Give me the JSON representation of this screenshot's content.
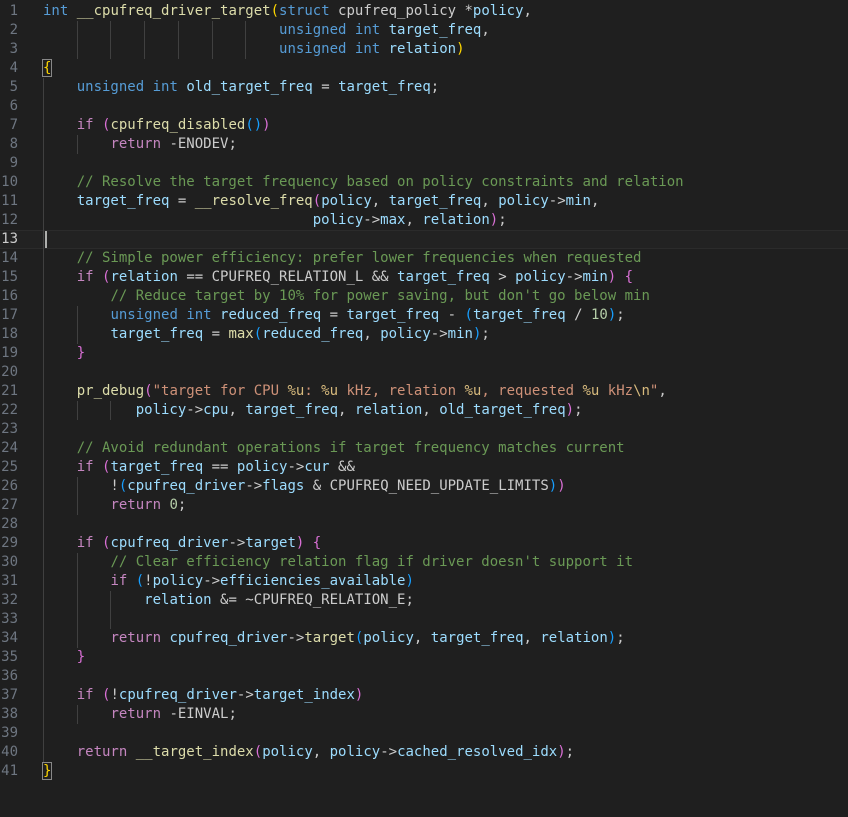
{
  "colors": {
    "background": "#1f1f1f",
    "line_number": "#6e7681",
    "keyword": "#569cd6",
    "control": "#c586c0",
    "function": "#dcdcaa",
    "variable": "#9cdcfe",
    "number": "#b5cea8",
    "string": "#ce9178",
    "comment": "#6a9955",
    "bracket_level_1": "#ffd700",
    "bracket_level_2": "#da70d6",
    "bracket_level_3": "#179fff"
  },
  "editor": {
    "current_line": 13,
    "lines": [
      {
        "n": "1",
        "t": [
          [
            "kw",
            "int"
          ],
          [
            "pl",
            " "
          ],
          [
            "fn",
            "__cpufreq_driver_target"
          ],
          [
            "b1",
            "("
          ],
          [
            "kw",
            "struct"
          ],
          [
            "pl",
            " cpufreq_policy "
          ],
          [
            "pl",
            "*"
          ],
          [
            "var",
            "policy"
          ],
          [
            "pl",
            ","
          ]
        ]
      },
      {
        "n": "2",
        "t": [
          [
            "pl",
            "                            "
          ],
          [
            "kw",
            "unsigned"
          ],
          [
            "pl",
            " "
          ],
          [
            "kw",
            "int"
          ],
          [
            "pl",
            " "
          ],
          [
            "var",
            "target_freq"
          ],
          [
            "pl",
            ","
          ]
        ]
      },
      {
        "n": "3",
        "t": [
          [
            "pl",
            "                            "
          ],
          [
            "kw",
            "unsigned"
          ],
          [
            "pl",
            " "
          ],
          [
            "kw",
            "int"
          ],
          [
            "pl",
            " "
          ],
          [
            "var",
            "relation"
          ],
          [
            "b1",
            ")"
          ]
        ]
      },
      {
        "n": "4",
        "t": [
          [
            "bm",
            "{"
          ]
        ]
      },
      {
        "n": "5",
        "t": [
          [
            "pl",
            "    "
          ],
          [
            "kw",
            "unsigned"
          ],
          [
            "pl",
            " "
          ],
          [
            "kw",
            "int"
          ],
          [
            "pl",
            " "
          ],
          [
            "var",
            "old_target_freq"
          ],
          [
            "pl",
            " = "
          ],
          [
            "var",
            "target_freq"
          ],
          [
            "pl",
            ";"
          ]
        ]
      },
      {
        "n": "6",
        "t": []
      },
      {
        "n": "7",
        "t": [
          [
            "pl",
            "    "
          ],
          [
            "ctl",
            "if"
          ],
          [
            "pl",
            " "
          ],
          [
            "b2",
            "("
          ],
          [
            "fn",
            "cpufreq_disabled"
          ],
          [
            "b3",
            "()"
          ],
          [
            "b2",
            ")"
          ]
        ]
      },
      {
        "n": "8",
        "t": [
          [
            "pl",
            "        "
          ],
          [
            "ctl",
            "return"
          ],
          [
            "pl",
            " -"
          ],
          [
            "const",
            "ENODEV"
          ],
          [
            "pl",
            ";"
          ]
        ]
      },
      {
        "n": "9",
        "t": []
      },
      {
        "n": "10",
        "t": [
          [
            "pl",
            "    "
          ],
          [
            "cmt",
            "// Resolve the target frequency based on policy constraints and relation"
          ]
        ]
      },
      {
        "n": "11",
        "t": [
          [
            "pl",
            "    "
          ],
          [
            "var",
            "target_freq"
          ],
          [
            "pl",
            " = "
          ],
          [
            "fn",
            "__resolve_freq"
          ],
          [
            "b2",
            "("
          ],
          [
            "var",
            "policy"
          ],
          [
            "pl",
            ", "
          ],
          [
            "var",
            "target_freq"
          ],
          [
            "pl",
            ", "
          ],
          [
            "var",
            "policy"
          ],
          [
            "pl",
            "->"
          ],
          [
            "var",
            "min"
          ],
          [
            "pl",
            ","
          ]
        ]
      },
      {
        "n": "12",
        "t": [
          [
            "pl",
            "                                "
          ],
          [
            "var",
            "policy"
          ],
          [
            "pl",
            "->"
          ],
          [
            "var",
            "max"
          ],
          [
            "pl",
            ", "
          ],
          [
            "var",
            "relation"
          ],
          [
            "b2",
            ")"
          ],
          [
            "pl",
            ";"
          ]
        ]
      },
      {
        "n": "13",
        "t": []
      },
      {
        "n": "14",
        "t": [
          [
            "pl",
            "    "
          ],
          [
            "cmt",
            "// Simple power efficiency: prefer lower frequencies when requested"
          ]
        ]
      },
      {
        "n": "15",
        "t": [
          [
            "pl",
            "    "
          ],
          [
            "ctl",
            "if"
          ],
          [
            "pl",
            " "
          ],
          [
            "b2",
            "("
          ],
          [
            "var",
            "relation"
          ],
          [
            "pl",
            " == "
          ],
          [
            "const",
            "CPUFREQ_RELATION_L"
          ],
          [
            "pl",
            " && "
          ],
          [
            "var",
            "target_freq"
          ],
          [
            "pl",
            " > "
          ],
          [
            "var",
            "policy"
          ],
          [
            "pl",
            "->"
          ],
          [
            "var",
            "min"
          ],
          [
            "b2",
            ")"
          ],
          [
            "pl",
            " "
          ],
          [
            "b2",
            "{"
          ]
        ]
      },
      {
        "n": "16",
        "t": [
          [
            "pl",
            "        "
          ],
          [
            "cmt",
            "// Reduce target by 10% for power saving, but don't go below min"
          ]
        ]
      },
      {
        "n": "17",
        "t": [
          [
            "pl",
            "        "
          ],
          [
            "kw",
            "unsigned"
          ],
          [
            "pl",
            " "
          ],
          [
            "kw",
            "int"
          ],
          [
            "pl",
            " "
          ],
          [
            "var",
            "reduced_freq"
          ],
          [
            "pl",
            " = "
          ],
          [
            "var",
            "target_freq"
          ],
          [
            "pl",
            " - "
          ],
          [
            "b3",
            "("
          ],
          [
            "var",
            "target_freq"
          ],
          [
            "pl",
            " / "
          ],
          [
            "num",
            "10"
          ],
          [
            "b3",
            ")"
          ],
          [
            "pl",
            ";"
          ]
        ]
      },
      {
        "n": "18",
        "t": [
          [
            "pl",
            "        "
          ],
          [
            "var",
            "target_freq"
          ],
          [
            "pl",
            " = "
          ],
          [
            "fn",
            "max"
          ],
          [
            "b3",
            "("
          ],
          [
            "var",
            "reduced_freq"
          ],
          [
            "pl",
            ", "
          ],
          [
            "var",
            "policy"
          ],
          [
            "pl",
            "->"
          ],
          [
            "var",
            "min"
          ],
          [
            "b3",
            ")"
          ],
          [
            "pl",
            ";"
          ]
        ]
      },
      {
        "n": "19",
        "t": [
          [
            "pl",
            "    "
          ],
          [
            "b2",
            "}"
          ]
        ]
      },
      {
        "n": "20",
        "t": []
      },
      {
        "n": "21",
        "t": [
          [
            "pl",
            "    "
          ],
          [
            "fn",
            "pr_debug"
          ],
          [
            "b2",
            "("
          ],
          [
            "str",
            "\"target for CPU "
          ],
          [
            "esc",
            "%u"
          ],
          [
            "str",
            ": "
          ],
          [
            "esc",
            "%u"
          ],
          [
            "str",
            " kHz, relation "
          ],
          [
            "esc",
            "%u"
          ],
          [
            "str",
            ", requested "
          ],
          [
            "esc",
            "%u"
          ],
          [
            "str",
            " kHz"
          ],
          [
            "esc",
            "\\n"
          ],
          [
            "str",
            "\""
          ],
          [
            "pl",
            ","
          ]
        ]
      },
      {
        "n": "22",
        "t": [
          [
            "pl",
            "           "
          ],
          [
            "var",
            "policy"
          ],
          [
            "pl",
            "->"
          ],
          [
            "var",
            "cpu"
          ],
          [
            "pl",
            ", "
          ],
          [
            "var",
            "target_freq"
          ],
          [
            "pl",
            ", "
          ],
          [
            "var",
            "relation"
          ],
          [
            "pl",
            ", "
          ],
          [
            "var",
            "old_target_freq"
          ],
          [
            "b2",
            ")"
          ],
          [
            "pl",
            ";"
          ]
        ]
      },
      {
        "n": "23",
        "t": []
      },
      {
        "n": "24",
        "t": [
          [
            "pl",
            "    "
          ],
          [
            "cmt",
            "// Avoid redundant operations if target frequency matches current"
          ]
        ]
      },
      {
        "n": "25",
        "t": [
          [
            "pl",
            "    "
          ],
          [
            "ctl",
            "if"
          ],
          [
            "pl",
            " "
          ],
          [
            "b2",
            "("
          ],
          [
            "var",
            "target_freq"
          ],
          [
            "pl",
            " == "
          ],
          [
            "var",
            "policy"
          ],
          [
            "pl",
            "->"
          ],
          [
            "var",
            "cur"
          ],
          [
            "pl",
            " &&"
          ]
        ]
      },
      {
        "n": "26",
        "t": [
          [
            "pl",
            "        !"
          ],
          [
            "b3",
            "("
          ],
          [
            "var",
            "cpufreq_driver"
          ],
          [
            "pl",
            "->"
          ],
          [
            "var",
            "flags"
          ],
          [
            "pl",
            " & "
          ],
          [
            "const",
            "CPUFREQ_NEED_UPDATE_LIMITS"
          ],
          [
            "b3",
            ")"
          ],
          [
            "b2",
            ")"
          ]
        ]
      },
      {
        "n": "27",
        "t": [
          [
            "pl",
            "        "
          ],
          [
            "ctl",
            "return"
          ],
          [
            "pl",
            " "
          ],
          [
            "num",
            "0"
          ],
          [
            "pl",
            ";"
          ]
        ]
      },
      {
        "n": "28",
        "t": []
      },
      {
        "n": "29",
        "t": [
          [
            "pl",
            "    "
          ],
          [
            "ctl",
            "if"
          ],
          [
            "pl",
            " "
          ],
          [
            "b2",
            "("
          ],
          [
            "var",
            "cpufreq_driver"
          ],
          [
            "pl",
            "->"
          ],
          [
            "var",
            "target"
          ],
          [
            "b2",
            ")"
          ],
          [
            "pl",
            " "
          ],
          [
            "b2",
            "{"
          ]
        ]
      },
      {
        "n": "30",
        "t": [
          [
            "pl",
            "        "
          ],
          [
            "cmt",
            "// Clear efficiency relation flag if driver doesn't support it"
          ]
        ]
      },
      {
        "n": "31",
        "t": [
          [
            "pl",
            "        "
          ],
          [
            "ctl",
            "if"
          ],
          [
            "pl",
            " "
          ],
          [
            "b3",
            "("
          ],
          [
            "pl",
            "!"
          ],
          [
            "var",
            "policy"
          ],
          [
            "pl",
            "->"
          ],
          [
            "var",
            "efficiencies_available"
          ],
          [
            "b3",
            ")"
          ]
        ]
      },
      {
        "n": "32",
        "t": [
          [
            "pl",
            "            "
          ],
          [
            "var",
            "relation"
          ],
          [
            "pl",
            " &= ~"
          ],
          [
            "const",
            "CPUFREQ_RELATION_E"
          ],
          [
            "pl",
            ";"
          ]
        ]
      },
      {
        "n": "33",
        "t": []
      },
      {
        "n": "34",
        "t": [
          [
            "pl",
            "        "
          ],
          [
            "ctl",
            "return"
          ],
          [
            "pl",
            " "
          ],
          [
            "var",
            "cpufreq_driver"
          ],
          [
            "pl",
            "->"
          ],
          [
            "fn",
            "target"
          ],
          [
            "b3",
            "("
          ],
          [
            "var",
            "policy"
          ],
          [
            "pl",
            ", "
          ],
          [
            "var",
            "target_freq"
          ],
          [
            "pl",
            ", "
          ],
          [
            "var",
            "relation"
          ],
          [
            "b3",
            ")"
          ],
          [
            "pl",
            ";"
          ]
        ]
      },
      {
        "n": "35",
        "t": [
          [
            "pl",
            "    "
          ],
          [
            "b2",
            "}"
          ]
        ]
      },
      {
        "n": "36",
        "t": []
      },
      {
        "n": "37",
        "t": [
          [
            "pl",
            "    "
          ],
          [
            "ctl",
            "if"
          ],
          [
            "pl",
            " "
          ],
          [
            "b2",
            "("
          ],
          [
            "pl",
            "!"
          ],
          [
            "var",
            "cpufreq_driver"
          ],
          [
            "pl",
            "->"
          ],
          [
            "var",
            "target_index"
          ],
          [
            "b2",
            ")"
          ]
        ]
      },
      {
        "n": "38",
        "t": [
          [
            "pl",
            "        "
          ],
          [
            "ctl",
            "return"
          ],
          [
            "pl",
            " -"
          ],
          [
            "const",
            "EINVAL"
          ],
          [
            "pl",
            ";"
          ]
        ]
      },
      {
        "n": "39",
        "t": []
      },
      {
        "n": "40",
        "t": [
          [
            "pl",
            "    "
          ],
          [
            "ctl",
            "return"
          ],
          [
            "pl",
            " "
          ],
          [
            "fn",
            "__target_index"
          ],
          [
            "b2",
            "("
          ],
          [
            "var",
            "policy"
          ],
          [
            "pl",
            ", "
          ],
          [
            "var",
            "policy"
          ],
          [
            "pl",
            "->"
          ],
          [
            "var",
            "cached_resolved_idx"
          ],
          [
            "b2",
            ")"
          ],
          [
            "pl",
            ";"
          ]
        ]
      },
      {
        "n": "41",
        "t": [
          [
            "bm",
            "}"
          ]
        ]
      }
    ]
  }
}
